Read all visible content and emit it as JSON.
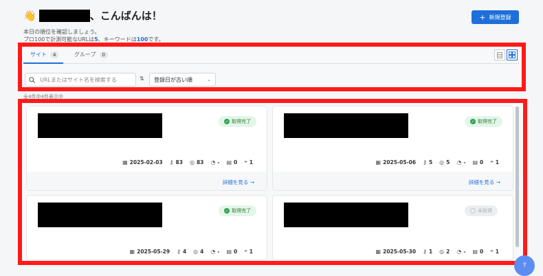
{
  "header": {
    "greeting": "、こんばんは！",
    "sub_line1": "本日の順位を確認しましょう。",
    "sub_line2_prefix": "プロ100で計測可能なURLは",
    "url_limit": "5",
    "sub_line2_mid": "、キーワードは",
    "kw_limit": "100",
    "sub_line2_suffix": "です。",
    "new_button": "新規登録"
  },
  "tabs": [
    {
      "label": "サイト",
      "count": "4"
    },
    {
      "label": "グループ",
      "count": "0"
    }
  ],
  "search": {
    "placeholder": "URLまたはサイト名を検索する"
  },
  "sort": {
    "selected": "登録日が古い順"
  },
  "list_hint": "全4件中4件表示中",
  "cards": [
    {
      "status": "取得完了",
      "done": true,
      "date": "2025-02-03",
      "keys": "83",
      "targets": "83",
      "speed": "-",
      "pages": "0",
      "locations": "1",
      "detail": "詳細を見る"
    },
    {
      "status": "取得完了",
      "done": true,
      "date": "2025-05-06",
      "keys": "5",
      "targets": "5",
      "speed": "-",
      "pages": "0",
      "locations": "1",
      "detail": "詳細を見る"
    },
    {
      "status": "取得完了",
      "done": true,
      "date": "2025-05-29",
      "keys": "4",
      "targets": "4",
      "speed": "-",
      "pages": "0",
      "locations": "1",
      "detail": ""
    },
    {
      "status": "未取得",
      "done": false,
      "date": "2025-05-30",
      "keys": "1",
      "targets": "2",
      "speed": "-",
      "pages": "0",
      "locations": "1",
      "detail": ""
    }
  ]
}
